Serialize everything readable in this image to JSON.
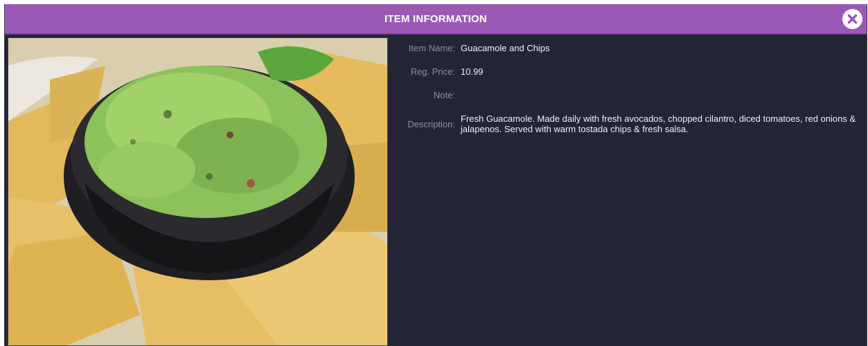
{
  "header": {
    "title": "ITEM INFORMATION",
    "accent_color": "#9b59b6"
  },
  "close_button": {
    "icon": "close-icon"
  },
  "photo": {
    "subject": "guacamole-and-chips-image"
  },
  "details": {
    "item_name_label": "Item Name:",
    "item_name_value": "Guacamole and Chips",
    "price_label": "Reg. Price:",
    "price_value": "10.99",
    "note_label": "Note:",
    "note_value": "",
    "description_label": "Description:",
    "description_value": "Fresh Guacamole. Made daily with fresh avocados, chopped cilantro, diced tomatoes, red onions & jalapenos. Served with warm tostada chips & fresh salsa."
  }
}
